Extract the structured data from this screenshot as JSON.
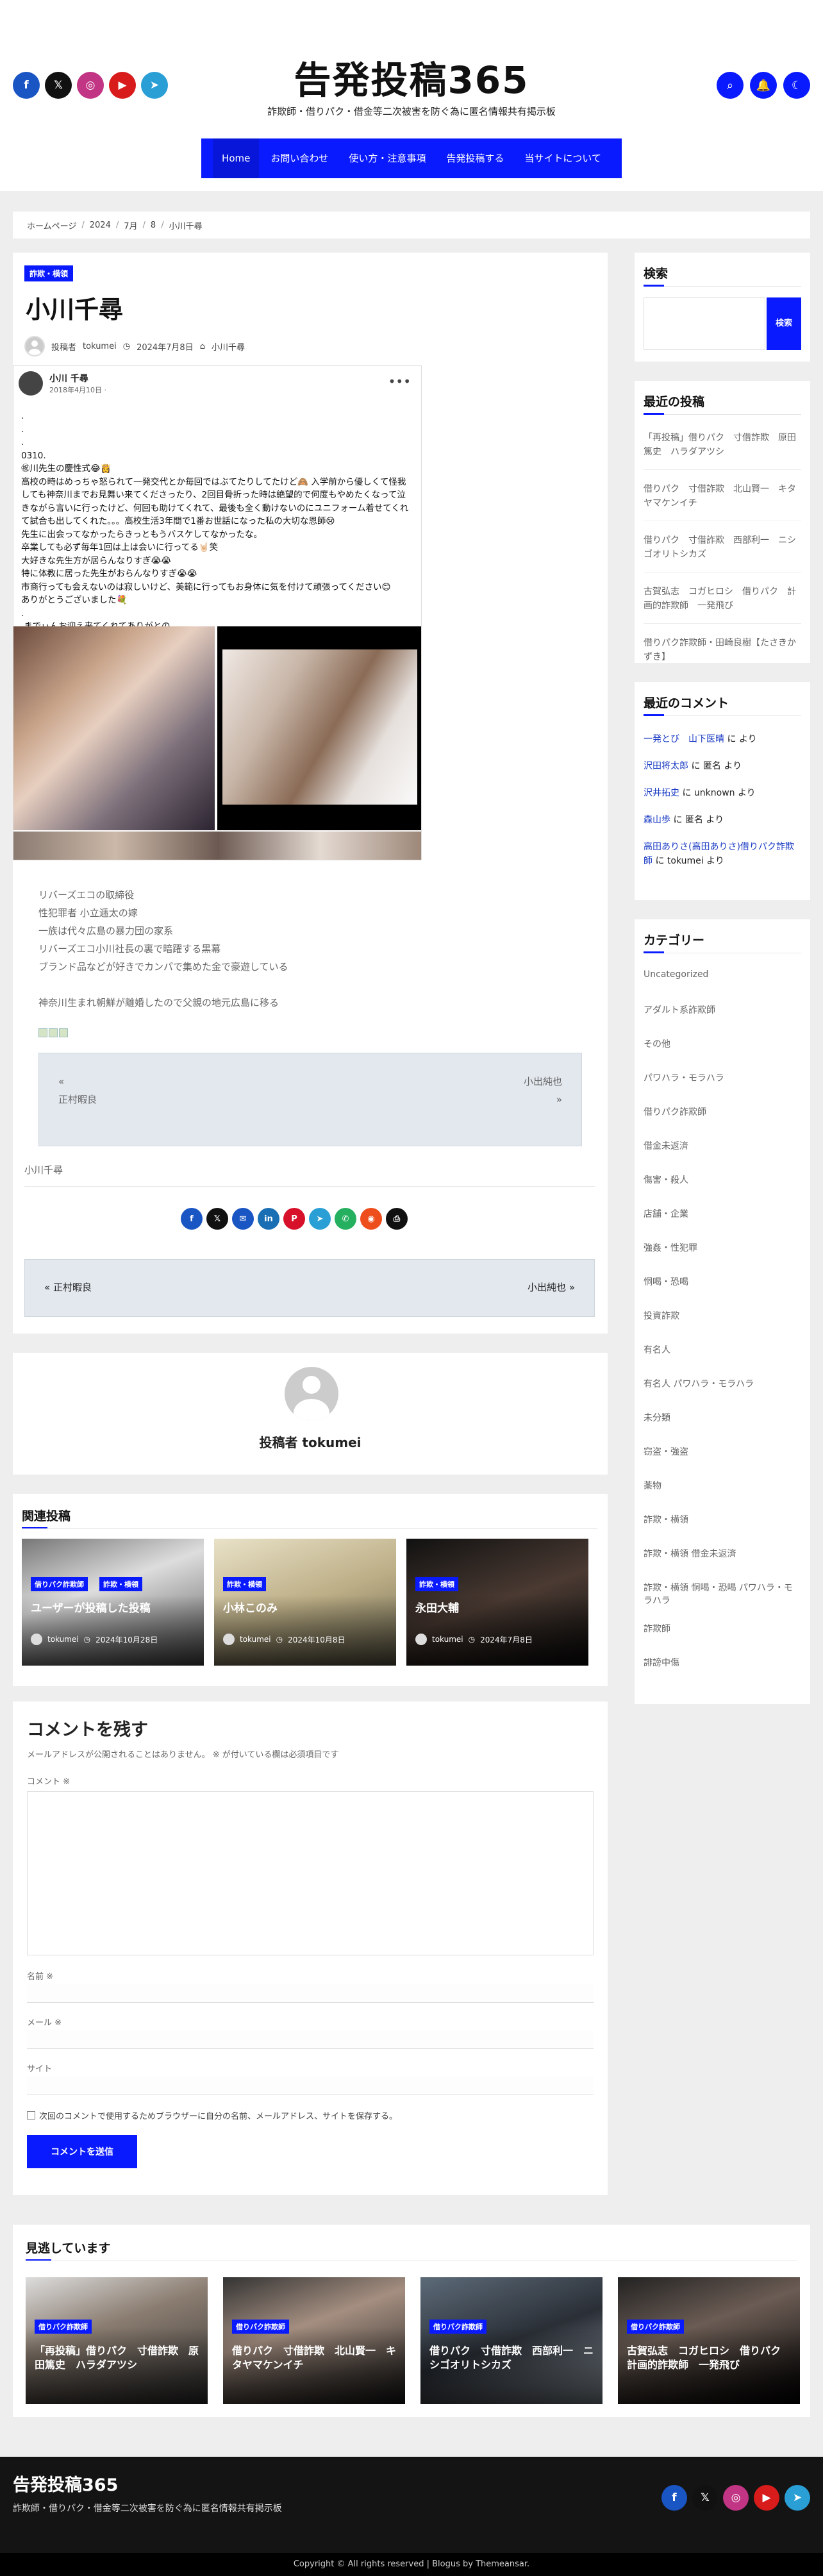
{
  "header": {
    "title": "告発投稿365",
    "description": "詐欺師・借りパク・借金等二次被害を防ぐ為に匿名情報共有掲示板",
    "socials": [
      {
        "name": "facebook",
        "glyph": "f"
      },
      {
        "name": "x",
        "glyph": "𝕏"
      },
      {
        "name": "instagram",
        "glyph": "◎"
      },
      {
        "name": "youtube",
        "glyph": "▶"
      },
      {
        "name": "telegram",
        "glyph": "➤"
      }
    ],
    "icons": [
      {
        "name": "search",
        "glyph": "⌕"
      },
      {
        "name": "bell",
        "glyph": "🔔"
      },
      {
        "name": "moon",
        "glyph": "☾"
      }
    ]
  },
  "nav": [
    "Home",
    "お問い合わせ",
    "使い方・注意事項",
    "告発投稿する",
    "当サイトについて"
  ],
  "breadcrumb": [
    "ホームページ",
    "2024",
    "7月",
    "8",
    "小川千尋"
  ],
  "post": {
    "category": "詐欺・横領",
    "title": "小川千尋",
    "author_label": "投稿者",
    "author": "tokumei",
    "date": "2024年7月8日",
    "tag": "小川千尋",
    "embed": {
      "name": "小川 千尋",
      "date": "2018年4月10日 · ",
      "text": ".\n.\n.\n0310.\n㊗川先生の慶性式😂👸\n高校の時はめっちゃ怒られて一発交代とか毎回ではぶてたりしてたけど🙈 入学前から優しくて怪我しても神奈川までお見舞い来てくださったり、2回目骨折った時は絶望的で何度もやめたくなって泣きながら言いに行ったけど、何回も助けてくれて、最後も全く動けないのにユニフォーム着せてくれて試合も出してくれた。。。高校生活3年間で1番お世話になった私の大切な恩師😢\n先生に出会ってなかったらきっともうバスケしてなかったな。\n卒業しても必ず毎年1回は上は会いに行ってる🤘🏻笑\n大好きな先生方が居らんなりすぎ😭😭\n特に体教に居った先生がおらんなりすぎ😭😭\n市商行っても会えないのは寂しいけど、美範に行ってもお身体に気を付けて頑張ってください😊\nありがとうございました💐\n.\n.までぃんお迎え来てくれてありがとの"
    },
    "body": [
      "リバーズエコの取締役",
      "性犯罪者 小立逓太の嫁",
      "一族は代々広島の暴力団の家系",
      "リバーズエコ小川社長の裏で暗躍する黒幕",
      "ブランド品などが好きでカンパで集めた金で豪遊している",
      "",
      "神奈川生まれ朝鮮が離婚したので父親の地元広島に移る"
    ],
    "prevnext": {
      "prev_arrow": "«",
      "prev": "正村暇良",
      "next": "小出純也",
      "next_arrow": "»"
    },
    "bottom_tag": "小川千尋",
    "share": [
      {
        "name": "facebook",
        "glyph": "f",
        "color": "#1a55c4"
      },
      {
        "name": "x",
        "glyph": "𝕏",
        "color": "#111111"
      },
      {
        "name": "email",
        "glyph": "✉",
        "color": "#1a55c4"
      },
      {
        "name": "linkedin",
        "glyph": "in",
        "color": "#1a6fb4"
      },
      {
        "name": "pinterest",
        "glyph": "P",
        "color": "#d8112a"
      },
      {
        "name": "telegram",
        "glyph": "➤",
        "color": "#2a9fd6"
      },
      {
        "name": "whatsapp",
        "glyph": "✆",
        "color": "#25b060"
      },
      {
        "name": "reddit",
        "glyph": "◉",
        "color": "#ee4d1c"
      },
      {
        "name": "print",
        "glyph": "⎙",
        "color": "#111111"
      }
    ],
    "nav_prev": "« 正村暇良",
    "nav_next": "小出純也 »"
  },
  "author_box": {
    "label": "投稿者",
    "name": "tokumei"
  },
  "related": {
    "title": "関連投稿",
    "items": [
      {
        "badges": [
          "借りパク詐欺師",
          "詐欺・横領"
        ],
        "title": "ユーザーが投稿した投稿",
        "author": "tokumei",
        "date": "2024年10月28日"
      },
      {
        "badges": [
          "詐欺・横領"
        ],
        "title": "小林このみ",
        "author": "tokumei",
        "date": "2024年10月8日"
      },
      {
        "badges": [
          "詐欺・横領"
        ],
        "title": "永田大輔",
        "author": "tokumei",
        "date": "2024年7月8日"
      }
    ]
  },
  "comment": {
    "title": "コメントを残す",
    "note": "メールアドレスが公開されることはありません。 ※ が付いている欄は必須項目です",
    "comment_label": "コメント ※",
    "name_label": "名前 ※",
    "email_label": "メール ※",
    "site_label": "サイト",
    "checkbox": "次回のコメントで使用するためブラウザーに自分の名前、メールアドレス、サイトを保存する。",
    "submit": "コメントを送信"
  },
  "seeing": {
    "title": "見逃しています",
    "items": [
      {
        "badge": "借りパク詐欺師",
        "title": "「再投稿」借りパク　寸借詐欺　原田篤史　ハラダアツシ"
      },
      {
        "badge": "借りパク詐欺師",
        "title": "借りパク　寸借詐欺　北山賢一　キタヤマケンイチ"
      },
      {
        "badge": "借りパク詐欺師",
        "title": "借りパク　寸借詐欺　西部利一　ニシゴオリトシカズ"
      },
      {
        "badge": "借りパク詐欺師",
        "title": "古賀弘志　コガヒロシ　借りパク　計画的詐欺師　一発飛び"
      }
    ]
  },
  "sidebar": {
    "search": {
      "title": "検索",
      "button": "検索"
    },
    "recent_posts": {
      "title": "最近の投稿",
      "items": [
        "「再投稿」借りパク　寸借詐欺　原田篤史　ハラダアツシ",
        "借りパク　寸借詐欺　北山賢一　キタヤマケンイチ",
        "借りパク　寸借詐欺　西部利一　ニシゴオリトシカズ",
        "古賀弘志　コガヒロシ　借りパク　計画的詐欺師　一発飛び",
        "借りパク詐欺師・田崎良樹【たさきかずき】"
      ]
    },
    "recent_comments": {
      "title": "最近のコメント",
      "items": [
        {
          "author": "一発とび　山下医晴",
          "text": " に より"
        },
        {
          "author": "沢田将太郎",
          "text": " に 匿名 より"
        },
        {
          "author": "沢井拓史",
          "text": " に unknown より"
        },
        {
          "author": "森山歩",
          "text": " に 匿名 より"
        },
        {
          "author": "高田ありさ(高田ありさ)借りパク詐欺師",
          "text": " に tokumei より"
        }
      ]
    },
    "categories": {
      "title": "カテゴリー",
      "items": [
        "Uncategorized",
        "アダルト系詐欺師",
        "その他",
        "パワハラ・モラハラ",
        "借りパク詐欺師",
        "借金未返済",
        "傷害・殺人",
        "店舗・企業",
        "強姦・性犯罪",
        "恫喝・恐喝",
        "投資詐欺",
        "有名人",
        "有名人 パワハラ・モラハラ",
        "未分類",
        "窃盗・強盗",
        "薬物",
        "詐欺・横領",
        "詐欺・横領 借金未返済",
        "詐欺・横領 恫喝・恐喝 パワハラ・モラハラ",
        "詐欺師",
        "誹謗中傷"
      ]
    }
  },
  "footer": {
    "title": "告発投稿365",
    "description": "詐欺師・借りパク・借金等二次被害を防ぐ為に匿名情報共有掲示板",
    "copyright": "Copyright © All rights reserved | Blogus by Themeansar."
  }
}
